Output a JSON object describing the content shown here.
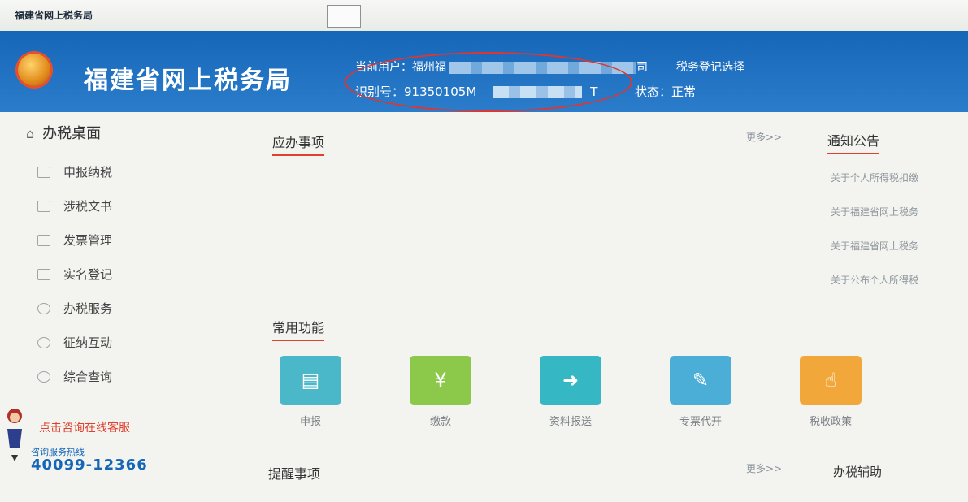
{
  "window": {
    "title": "福建省网上税务局"
  },
  "header": {
    "site_name": "福建省网上税务局",
    "user_label": "当前用户：福州福",
    "user_suffix": "司",
    "registration_select": "税务登记选择",
    "id_label": "识别号：91350105M",
    "id_suffix": "T",
    "status": "状态：正常"
  },
  "sidebar": {
    "title": "办税桌面",
    "items": [
      {
        "label": "申报纳税",
        "icon": "report-icon"
      },
      {
        "label": "涉税文书",
        "icon": "mail-icon"
      },
      {
        "label": "发票管理",
        "icon": "invoice-icon"
      },
      {
        "label": "实名登记",
        "icon": "id-icon"
      },
      {
        "label": "办税服务",
        "icon": "user-icon"
      },
      {
        "label": "征纳互动",
        "icon": "chat-icon"
      },
      {
        "label": "综合查询",
        "icon": "search-icon"
      }
    ]
  },
  "support": {
    "online_service": "点击咨询在线客服",
    "hotline_label": "咨询服务热线",
    "hotline_number": "40099-12366"
  },
  "main": {
    "todo_title": "应办事项",
    "todo_more": "更多>>",
    "common_title": "常用功能",
    "functions": [
      {
        "label": "申报",
        "color": "#4bb8c9",
        "icon": "declare-icon"
      },
      {
        "label": "缴款",
        "color": "#8cc94a",
        "icon": "payment-icon"
      },
      {
        "label": "资料报送",
        "color": "#35b7c4",
        "icon": "submit-icon"
      },
      {
        "label": "专票代开",
        "color": "#4aaed6",
        "icon": "edit-icon"
      },
      {
        "label": "税收政策",
        "color": "#f2a73a",
        "icon": "hand-pointer-icon"
      }
    ],
    "reminder_title": "提醒事项",
    "reminder_more": "更多>>"
  },
  "notices": {
    "title": "通知公告",
    "items": [
      "关于个人所得税扣缴",
      "关于福建省网上税务",
      "关于福建省网上税务",
      "关于公布个人所得税"
    ]
  },
  "aux": {
    "title": "办税辅助"
  },
  "colors": {
    "header_blue": "#1f6fc1",
    "accent_red": "#e0402e"
  }
}
